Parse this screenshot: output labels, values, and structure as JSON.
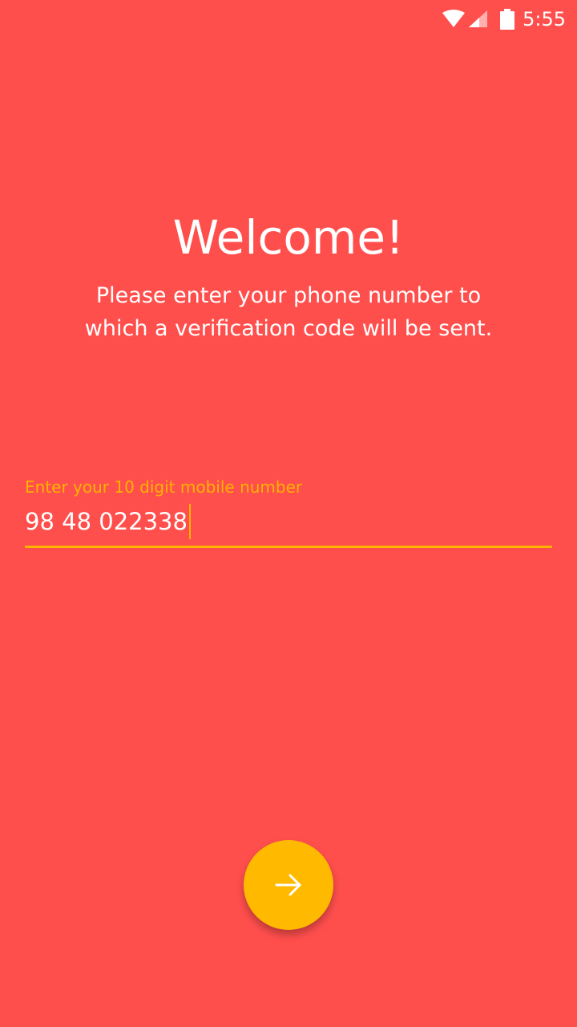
{
  "status_bar": {
    "time": "5:55",
    "icons": [
      "wifi-icon",
      "signal-icon",
      "battery-icon"
    ]
  },
  "main": {
    "title": "Welcome!",
    "subtitle": "Please enter your phone number to which a verification code will be sent."
  },
  "phone_field": {
    "label": "Enter your 10 digit mobile number",
    "value": "98 48 022338"
  },
  "next_button": {
    "icon": "arrow-right-icon"
  },
  "colors": {
    "background": "#FF4F4D",
    "accent": "#FFB300",
    "fab": "#FFBA00",
    "text": "#FFFFFF"
  }
}
